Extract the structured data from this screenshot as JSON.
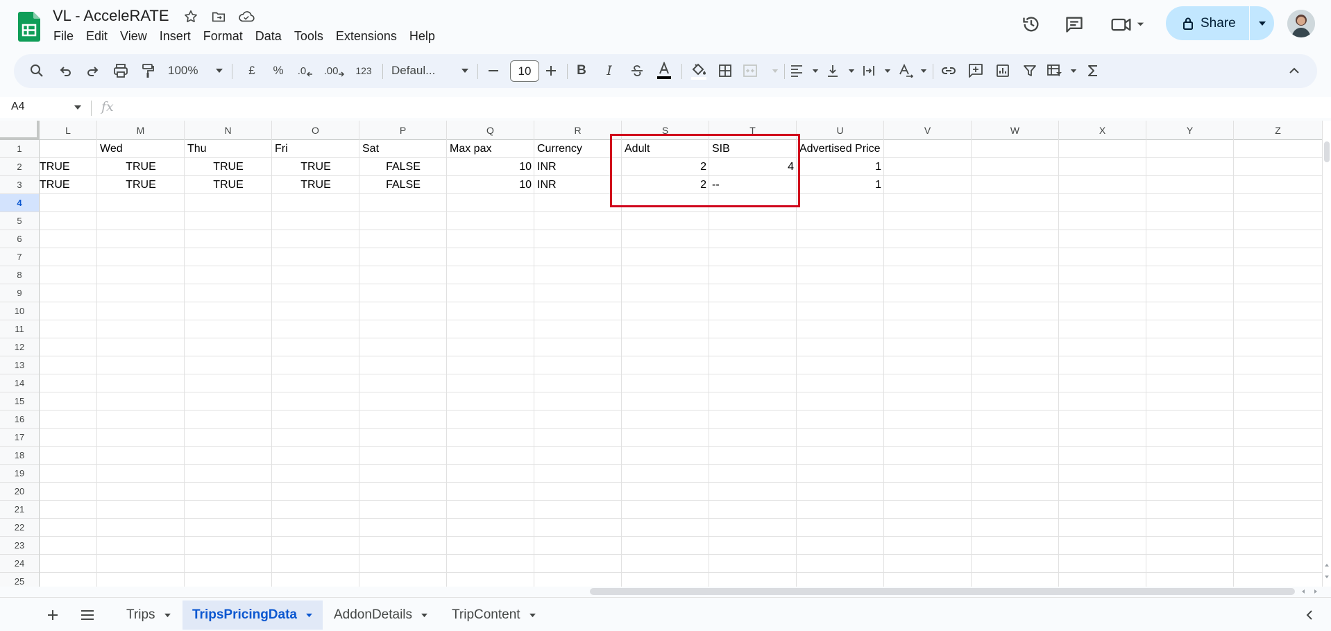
{
  "app": {
    "doc_title": "VL - AcceleRATE",
    "menu": [
      "File",
      "Edit",
      "View",
      "Insert",
      "Format",
      "Data",
      "Tools",
      "Extensions",
      "Help"
    ],
    "share_label": "Share",
    "colors": {
      "accent": "#0b57d0",
      "share_bg": "#c2e7ff",
      "highlight": "#d0021b",
      "sheets_green": "#0f9d58"
    }
  },
  "toolbar": {
    "zoom": "100%",
    "currency_symbol": "£",
    "percent_symbol": "%",
    "decimal_decrease": ".0",
    "decimal_increase": ".00",
    "number_format": "123",
    "font_name": "Defaul...",
    "font_size": "10"
  },
  "formula_bar": {
    "cell_ref": "A4",
    "fx_label": "fx",
    "content": ""
  },
  "grid": {
    "columns": [
      "L",
      "M",
      "N",
      "O",
      "P",
      "Q",
      "R",
      "S",
      "T",
      "U",
      "V",
      "W",
      "X",
      "Y",
      "Z"
    ],
    "row_numbers": [
      "1",
      "2",
      "3",
      "4",
      "5",
      "6",
      "7",
      "8",
      "9",
      "10",
      "11",
      "12",
      "13",
      "14",
      "15",
      "16",
      "17",
      "18",
      "19",
      "20",
      "21",
      "22",
      "23",
      "24",
      "25"
    ],
    "active_row": "4",
    "rows": [
      [
        "",
        "Wed",
        "Thu",
        "Fri",
        "Sat",
        "Max pax",
        "Currency",
        "Adult",
        "SIB",
        "Advertised Price",
        "",
        "",
        "",
        "",
        ""
      ],
      [
        "TRUE",
        "TRUE",
        "TRUE",
        "TRUE",
        "FALSE",
        "10",
        "INR",
        "2",
        "4",
        "1",
        "",
        "",
        "",
        "",
        ""
      ],
      [
        "TRUE",
        "TRUE",
        "TRUE",
        "TRUE",
        "FALSE",
        "10",
        "INR",
        "2",
        "--",
        "1",
        "",
        "",
        "",
        "",
        ""
      ]
    ]
  },
  "sheets": {
    "tabs": [
      "Trips",
      "TripsPricingData",
      "AddonDetails",
      "TripContent"
    ],
    "active": "TripsPricingData"
  }
}
